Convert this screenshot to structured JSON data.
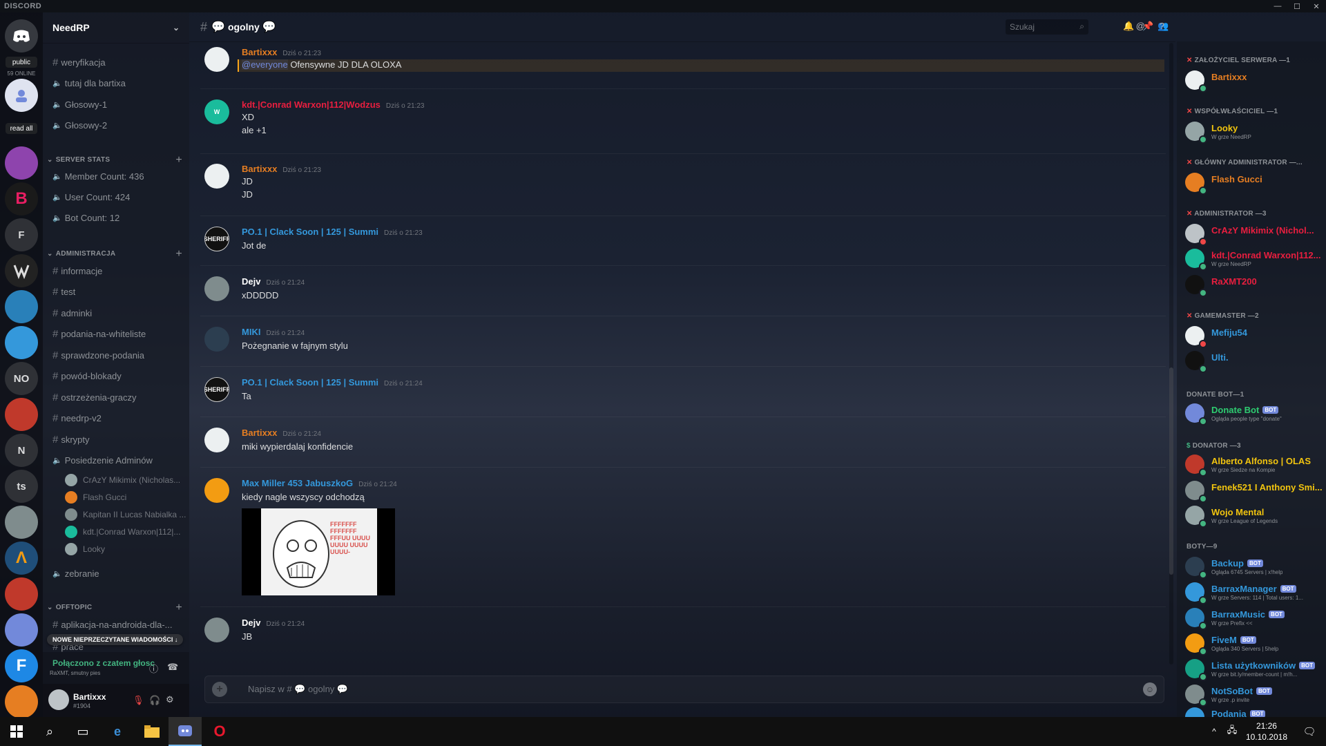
{
  "window": {
    "title": "DISCORD",
    "controls": [
      "—",
      "☐",
      "✕"
    ]
  },
  "rail": {
    "public_label": "public",
    "online_label": "59 ONLINE",
    "read_all_label": "read all",
    "letters": [
      "F",
      "NO",
      "N",
      "ts",
      "F"
    ]
  },
  "guild": {
    "name": "NeedRP"
  },
  "channels": {
    "top": [
      "weryfikacja",
      "tutaj dla bartixa",
      "Głosowy-1",
      "Głosowy-2"
    ],
    "cat_stats": "SERVER STATS",
    "stats": [
      "Member Count: 436",
      "User Count: 424",
      "Bot Count: 12"
    ],
    "cat_admin": "ADMINISTRACJA",
    "admin": [
      "informacje",
      "test",
      "adminki",
      "podania-na-whiteliste",
      "sprawdzone-podania",
      "powód-blokady",
      "ostrzeżenia-graczy",
      "needrp-v2",
      "skrypty"
    ],
    "voice_channel": "Posiedzenie Adminów",
    "voice_users": [
      "CrAzY Mikimix (Nicholas...",
      "Flash Gucci",
      "Kapitan II Lucas Nabialka ...",
      "kdt.|Conrad Warxon|112|...",
      "Looky"
    ],
    "zebranie": "zebranie",
    "cat_offtopic": "OFFTOPIC",
    "offtopic": [
      "aplikacja-na-androida-dla-...",
      "prace"
    ],
    "unread_pill": "NOWE NIEPRZECZYTANE WIADOMOŚCI ↓"
  },
  "voice": {
    "connected": "Połączono z czatem głosc",
    "sub": "RaXMT, smutny pies"
  },
  "user": {
    "name": "Bartixxx",
    "tag": "#1904"
  },
  "chat": {
    "channel_name": "ogolny",
    "search_placeholder": "Szukaj",
    "input_placeholder": "Napisz w # 💬 ogolny 💬",
    "messages": [
      {
        "author": "Bartixxx",
        "time": "Dziś o 21:23",
        "mention": "@everyone",
        "lines": [
          "Ofensywne JD DLA OLOXA"
        ],
        "color": "#e67e22"
      },
      {
        "author": "kdt.|Conrad Warxon|112|Wodzus",
        "time": "Dziś o 21:23",
        "lines": [
          "XD",
          "ale +1"
        ],
        "color": "#e91e3f"
      },
      {
        "author": "Bartixxx",
        "time": "Dziś o 21:23",
        "lines": [
          "JD",
          "JD"
        ],
        "color": "#e67e22"
      },
      {
        "author": "PO.1 | Clack Soon | 125 | Summi",
        "time": "Dziś o 21:23",
        "lines": [
          "Jot de"
        ],
        "color": "#3498db"
      },
      {
        "author": "Dejv",
        "time": "Dziś o 21:24",
        "lines": [
          "xDDDDD"
        ],
        "color": "#ffffff"
      },
      {
        "author": "MIKI",
        "time": "Dziś o 21:24",
        "lines": [
          "Pożegnanie w fajnym stylu"
        ],
        "color": "#3498db"
      },
      {
        "author": "PO.1 | Clack Soon | 125 | Summi",
        "time": "Dziś o 21:24",
        "lines": [
          "Ta"
        ],
        "color": "#3498db"
      },
      {
        "author": "Bartixxx",
        "time": "Dziś o 21:24",
        "lines": [
          "miki wypierdalaj konfidencie"
        ],
        "color": "#e67e22"
      },
      {
        "author": "Max Miller 453 JabuszkoG",
        "time": "Dziś o 21:24",
        "lines": [
          "kiedy nagle wszyscy odchodzą"
        ],
        "color": "#3498db"
      },
      {
        "author": "Dejv",
        "time": "Dziś o 21:24",
        "lines": [
          "JB"
        ],
        "color": "#ffffff"
      }
    ],
    "meme_text": "FFFFFFF FFFFFFF FFFUU UUUU UUUU UUUU UUUU-"
  },
  "members": {
    "roles": [
      "ZAŁOŻYCIEL SERWERA —1",
      "WSPÓŁWŁAŚCICIEL —1",
      "GŁÓWNY ADMINISTRATOR —...",
      "ADMINISTRATOR —3",
      "GAMEMASTER —2",
      "DONATE BOT—1",
      "DONATOR —3",
      "BOTY—9"
    ],
    "list": [
      {
        "name": "Bartixxx",
        "color": "#e67e22",
        "activity": "",
        "bot": false
      },
      {
        "name": "Looky",
        "color": "#f1c40f",
        "activity": "W grze NeedRP",
        "bot": false
      },
      {
        "name": "Flash Gucci",
        "color": "#e67e22",
        "activity": "",
        "bot": false
      },
      {
        "name": "CrAzY Mikimix (Nichol...",
        "color": "#e91e3f",
        "activity": "",
        "bot": false
      },
      {
        "name": "kdt.|Conrad Warxon|112...",
        "color": "#e91e3f",
        "activity": "W grze NeedRP",
        "bot": false
      },
      {
        "name": "RaXMT200",
        "color": "#e91e3f",
        "activity": "",
        "bot": false
      },
      {
        "name": "Mefiju54",
        "color": "#3498db",
        "activity": "",
        "bot": false
      },
      {
        "name": "Ulti.",
        "color": "#3498db",
        "activity": "",
        "bot": false
      },
      {
        "name": "Donate Bot",
        "color": "#2ecc71",
        "activity": "Ogląda people type \"donate\"",
        "bot": true
      },
      {
        "name": "Alberto Alfonso | OLAS",
        "color": "#f1c40f",
        "activity": "W grze Siedze na Kompie",
        "bot": false
      },
      {
        "name": "Fenek521 I Anthony Smi...",
        "color": "#f1c40f",
        "activity": "",
        "bot": false
      },
      {
        "name": "Wojo Mental",
        "color": "#f1c40f",
        "activity": "W grze League of Legends",
        "bot": false
      },
      {
        "name": "Backup",
        "color": "#3498db",
        "activity": "Ogląda 6745 Servers | x!help",
        "bot": true
      },
      {
        "name": "BarraxManager",
        "color": "#3498db",
        "activity": "W grze Servers: 114 | Total users: 1...",
        "bot": true
      },
      {
        "name": "BarraxMusic",
        "color": "#3498db",
        "activity": "W grze Prefix <<",
        "bot": true
      },
      {
        "name": "FiveM",
        "color": "#3498db",
        "activity": "Ogląda 340 Servers | 5help",
        "bot": true
      },
      {
        "name": "Lista użytkowników",
        "color": "#3498db",
        "activity": "W grze bit.ly/member-count | m!h...",
        "bot": true
      },
      {
        "name": "NotSoBot",
        "color": "#3498db",
        "activity": "W grze .p invite",
        "bot": true
      },
      {
        "name": "Podania",
        "color": "#3498db",
        "activity": "",
        "bot": true
      }
    ],
    "bot_badge": "BOT"
  },
  "taskbar": {
    "time": "21:26",
    "date": "10.10.2018"
  },
  "colors": {
    "online": "#43b581",
    "dnd": "#f04747",
    "idle": "#faa61a",
    "blurple": "#7289da"
  }
}
